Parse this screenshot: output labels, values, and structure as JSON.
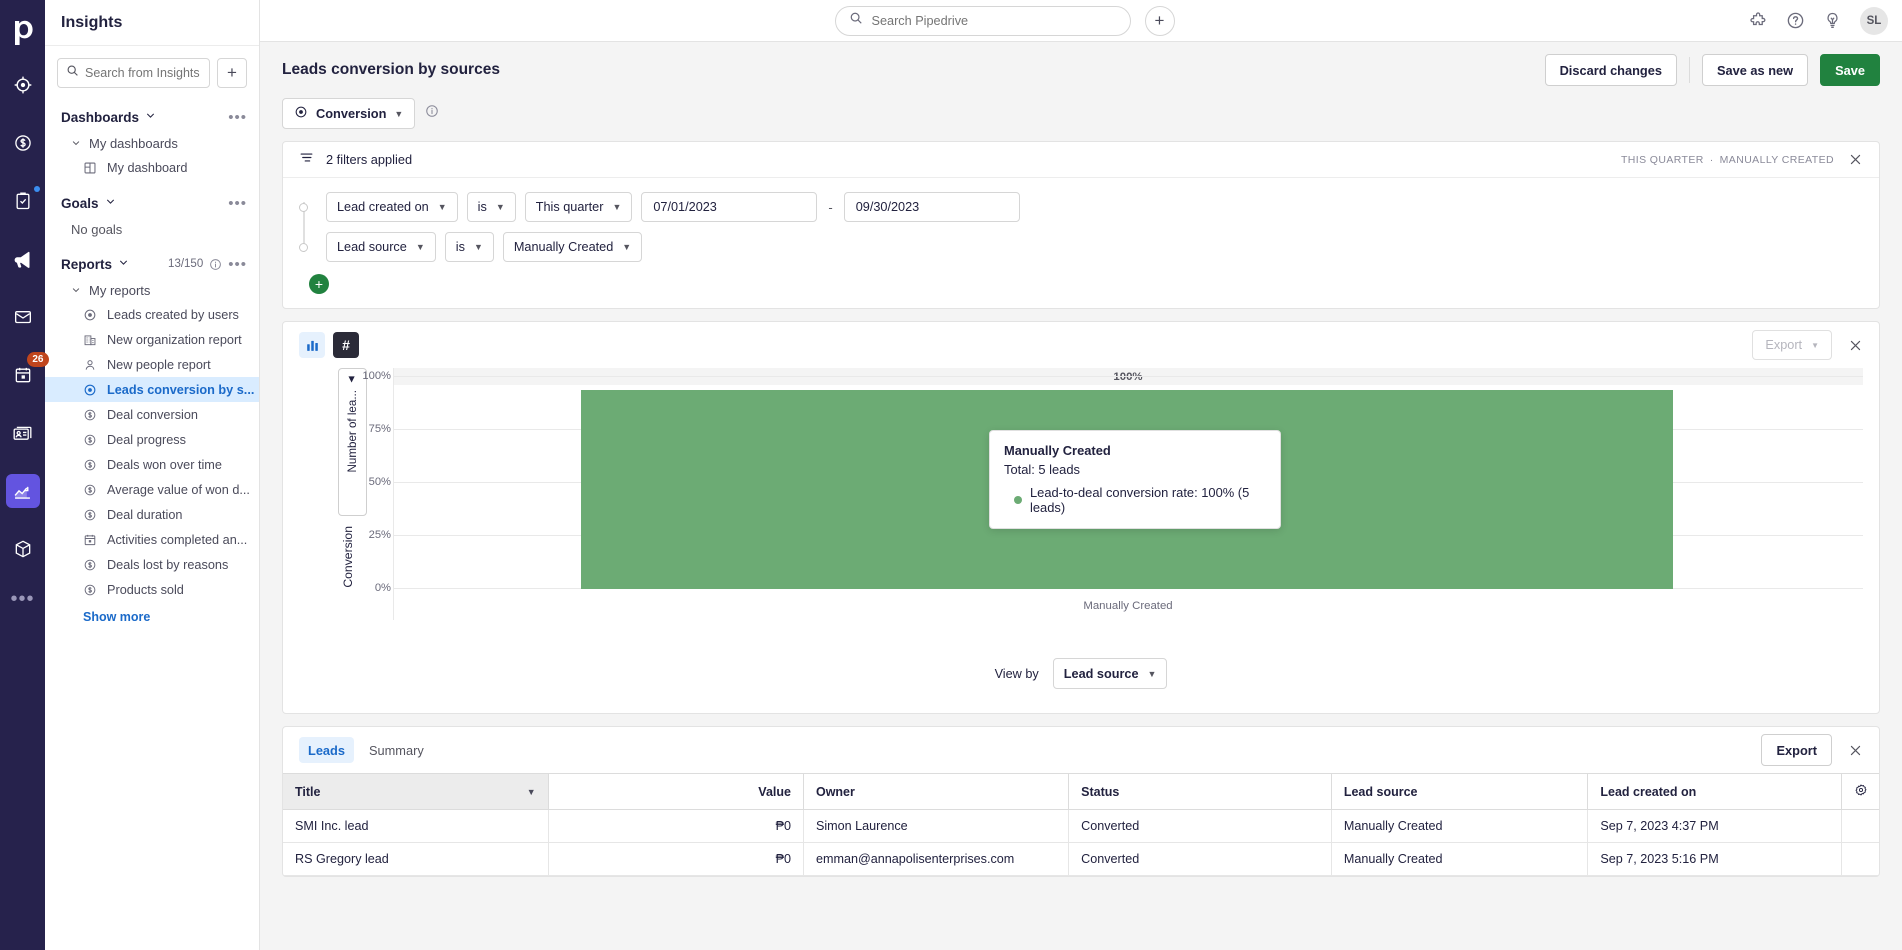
{
  "rail": {
    "logo": "pipedrive-logo",
    "items": [
      {
        "name": "leads-icon",
        "active": false,
        "dot": false,
        "badge": ""
      },
      {
        "name": "deals-icon",
        "active": false,
        "dot": false,
        "badge": ""
      },
      {
        "name": "activities-icon",
        "active": false,
        "dot": true,
        "badge": ""
      },
      {
        "name": "campaigns-icon",
        "active": false,
        "dot": false,
        "badge": ""
      },
      {
        "name": "mail-icon",
        "active": false,
        "dot": false,
        "badge": ""
      },
      {
        "name": "calendar-icon",
        "active": false,
        "dot": false,
        "badge": "26"
      },
      {
        "name": "contacts-icon",
        "active": false,
        "dot": false,
        "badge": ""
      },
      {
        "name": "insights-icon",
        "active": true,
        "dot": false,
        "badge": ""
      },
      {
        "name": "products-icon",
        "active": false,
        "dot": false,
        "badge": ""
      }
    ],
    "more": "•••"
  },
  "sidebar": {
    "title": "Insights",
    "search_placeholder": "Search from Insights",
    "add_label": "+",
    "dashboards": {
      "title": "Dashboards",
      "dots": "•••",
      "group": "My dashboards",
      "items": [
        {
          "label": "My dashboard",
          "icon": "dashboard-grid-icon"
        }
      ]
    },
    "goals": {
      "title": "Goals",
      "dots": "•••",
      "empty": "No goals"
    },
    "reports": {
      "title": "Reports",
      "count": "13/150",
      "dots": "•••",
      "group": "My reports",
      "items": [
        {
          "label": "Leads created by users",
          "icon": "target-icon",
          "active": false
        },
        {
          "label": "New organization report",
          "icon": "organization-icon",
          "active": false
        },
        {
          "label": "New people report",
          "icon": "person-icon",
          "active": false
        },
        {
          "label": "Leads conversion by s...",
          "icon": "target-icon",
          "active": true
        },
        {
          "label": "Deal conversion",
          "icon": "deal-icon",
          "active": false
        },
        {
          "label": "Deal progress",
          "icon": "deal-icon",
          "active": false
        },
        {
          "label": "Deals won over time",
          "icon": "deal-icon",
          "active": false
        },
        {
          "label": "Average value of won d...",
          "icon": "deal-icon",
          "active": false
        },
        {
          "label": "Deal duration",
          "icon": "deal-icon",
          "active": false
        },
        {
          "label": "Activities completed an...",
          "icon": "calendar-icon",
          "active": false
        },
        {
          "label": "Deals lost by reasons",
          "icon": "deal-icon",
          "active": false
        },
        {
          "label": "Products sold",
          "icon": "deal-icon",
          "active": false
        }
      ],
      "show_more": "Show more"
    }
  },
  "topbar": {
    "search_placeholder": "Search Pipedrive",
    "add_label": "+",
    "icons": [
      "puzzle-icon",
      "help-icon",
      "lightbulb-icon"
    ],
    "avatar_initials": "SL"
  },
  "report": {
    "title": "Leads conversion by sources",
    "type_pill": "Conversion",
    "actions": {
      "discard": "Discard changes",
      "save_as_new": "Save as new",
      "save": "Save"
    }
  },
  "filters": {
    "summary": "2 filters applied",
    "meta_left": "THIS QUARTER",
    "meta_sep": "·",
    "meta_right": "MANUALLY CREATED",
    "rows": [
      {
        "field": "Lead created on",
        "operator": "is",
        "value": "This quarter",
        "date_from": "07/01/2023",
        "date_to": "09/30/2023",
        "dash": "-"
      },
      {
        "field": "Lead source",
        "operator": "is",
        "value": "Manually Created"
      }
    ],
    "add_label": "+"
  },
  "chart_panel": {
    "viz_bar_icon": "bar-chart-icon",
    "viz_number_icon": "number-hash-icon",
    "export": "Export",
    "view_by_label": "View by",
    "view_by_value": "Lead source"
  },
  "chart_data": {
    "type": "bar",
    "title": "",
    "categories": [
      "Manually Created"
    ],
    "values": [
      100
    ],
    "data_labels": [
      "100%"
    ],
    "xlabel": "Manually Created",
    "ylabel": "Conversion",
    "secondary_ylabel": "Number of lea...",
    "ylim": [
      0,
      100
    ],
    "yticks": [
      0,
      25,
      50,
      75,
      100
    ],
    "ytick_labels": [
      "0%",
      "25%",
      "50%",
      "75%",
      "100%"
    ],
    "grid": true,
    "legend": "none",
    "series_color": "#6cab74",
    "tooltip": {
      "title": "Manually Created",
      "total": "Total: 5 leads",
      "metric": "Lead-to-deal conversion rate: 100% (5 leads)",
      "dot_color": "#6cab74"
    }
  },
  "table_panel": {
    "tabs": [
      {
        "label": "Leads",
        "active": true
      },
      {
        "label": "Summary",
        "active": false
      }
    ],
    "export": "Export",
    "gear_icon": "gear-icon",
    "columns": [
      {
        "label": "Title",
        "align": "left",
        "sorted": true
      },
      {
        "label": "Value",
        "align": "right",
        "sorted": false
      },
      {
        "label": "Owner",
        "align": "left",
        "sorted": false
      },
      {
        "label": "Status",
        "align": "left",
        "sorted": false
      },
      {
        "label": "Lead source",
        "align": "left",
        "sorted": false
      },
      {
        "label": "Lead created on",
        "align": "left",
        "sorted": false
      }
    ],
    "rows": [
      {
        "title": "SMI Inc. lead",
        "value": "₱0",
        "owner": "Simon Laurence",
        "status": "Converted",
        "lead_source": "Manually Created",
        "created_on": "Sep 7, 2023 4:37 PM"
      },
      {
        "title": "RS Gregory lead",
        "value": "₱0",
        "owner": "emman@annapolisenterprises.com",
        "status": "Converted",
        "lead_source": "Manually Created",
        "created_on": "Sep 7, 2023 5:16 PM"
      }
    ]
  }
}
